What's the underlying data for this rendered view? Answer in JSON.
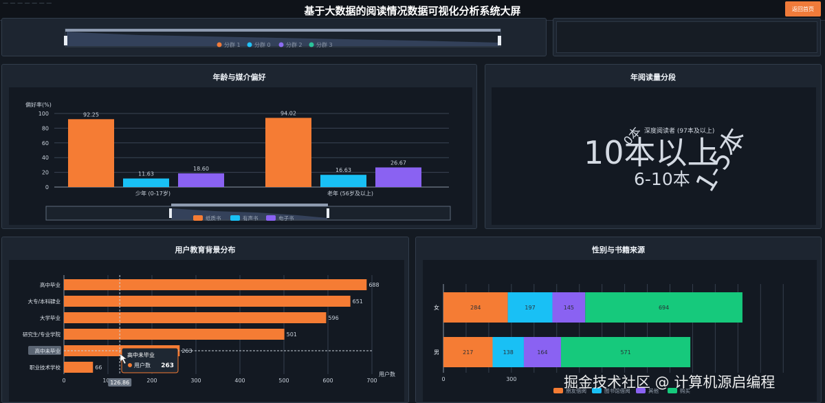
{
  "header": {
    "title": "基于大数据的阅读情况数据可视化分析系统大屏",
    "back_label": "返回首页"
  },
  "top_strip": {
    "legend": [
      "分群 1",
      "分群 0",
      "分群 2",
      "分群 3"
    ],
    "legend_colors": [
      "#f07b3a",
      "#22c3f7",
      "#8b6cf0",
      "#2bc39a"
    ]
  },
  "age_media": {
    "title": "年龄与媒介偏好",
    "chart_data": {
      "type": "bar",
      "ylabel": "偏好率(%)",
      "ylim": [
        0,
        100
      ],
      "yticks": [
        "100",
        "80",
        "60",
        "40",
        "20",
        "0"
      ],
      "categories": [
        "少年 (0-17岁)",
        "老年 (56岁及以上)"
      ],
      "series": [
        {
          "name": "纸质书",
          "color": "#f57c34",
          "values": [
            92.25,
            94.02
          ],
          "labels": [
            "92.25",
            "94.02"
          ]
        },
        {
          "name": "有声书",
          "color": "#19c0f5",
          "values": [
            11.63,
            16.63
          ],
          "labels": [
            "11.63",
            "16.63"
          ]
        },
        {
          "name": "电子书",
          "color": "#8a62f2",
          "values": [
            18.6,
            26.67
          ],
          "labels": [
            "18.60",
            "26.67"
          ]
        }
      ]
    }
  },
  "annual_reading": {
    "title": "年阅读量分段",
    "words": {
      "w1": "10本以上",
      "w2": "1-5本",
      "w3": "6-10本",
      "w4": "0本",
      "w5": "深度阅读者 (97本及以上)"
    }
  },
  "education": {
    "title": "用户教育背景分布",
    "chart_data": {
      "type": "bar",
      "orientation": "horizontal",
      "xlabel": "用户数",
      "xlim": [
        0,
        700
      ],
      "xticks": [
        "0",
        "100",
        "200",
        "300",
        "400",
        "500",
        "600",
        "700"
      ],
      "categories": [
        "高中毕业",
        "大专/本科肄业",
        "大学毕业",
        "研究生/专业学院",
        "高中未毕业",
        "职业技术学校"
      ],
      "values": [
        688,
        651,
        596,
        501,
        263,
        66
      ],
      "value_labels": [
        "688",
        "651",
        "596",
        "501",
        "263",
        "66"
      ],
      "color": "#f57c34"
    },
    "tooltip": {
      "title": "高中未毕业",
      "series": "用户数",
      "value": "263"
    },
    "pointer_value": "126.86"
  },
  "gender_source": {
    "title": "性别与书籍来源",
    "chart_data": {
      "type": "bar",
      "stacked": true,
      "orientation": "horizontal",
      "categories": [
        "女",
        "男"
      ],
      "xticks": [
        "0",
        "300"
      ],
      "series": [
        {
          "name": "朋友借阅",
          "color": "#f57c34",
          "values": [
            284,
            217
          ],
          "labels": [
            "284",
            "217"
          ]
        },
        {
          "name": "图书馆借阅",
          "color": "#19c0f5",
          "values": [
            197,
            138
          ],
          "labels": [
            "197",
            "138"
          ]
        },
        {
          "name": "其他",
          "color": "#8a62f2",
          "values": [
            145,
            164
          ],
          "labels": [
            "145",
            "164"
          ]
        },
        {
          "name": "购买",
          "color": "#16c97c",
          "values": [
            694,
            571
          ],
          "labels": [
            "694",
            "571"
          ]
        }
      ]
    }
  },
  "watermark": "掘金技术社区 @ 计算机源启编程"
}
